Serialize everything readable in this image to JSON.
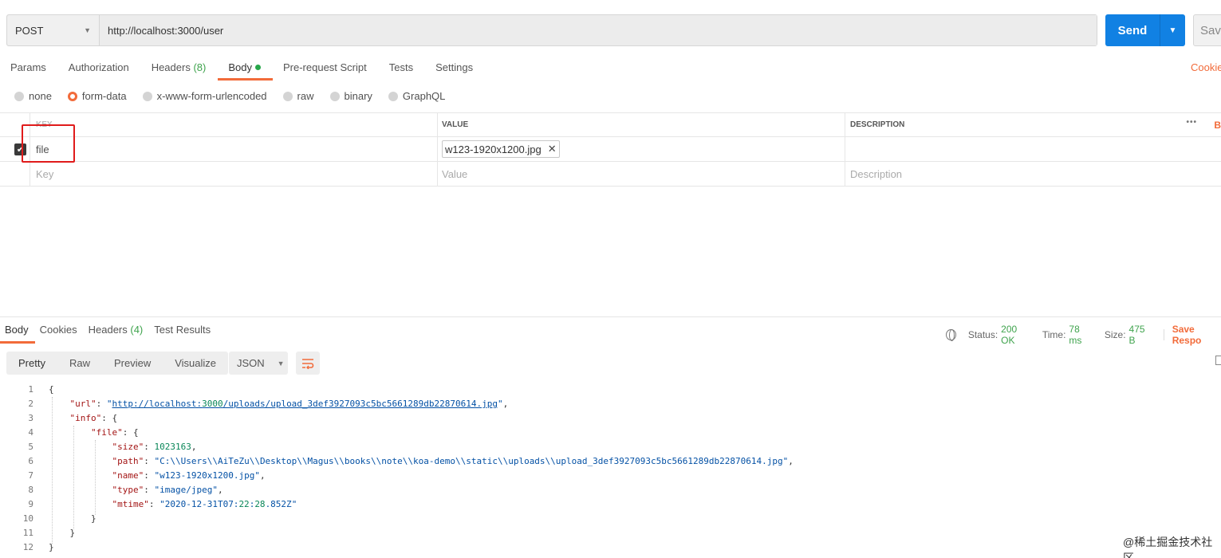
{
  "request": {
    "method": "POST",
    "url": "http://localhost:3000/user",
    "send_label": "Send",
    "save_label": "Save"
  },
  "req_tabs": [
    {
      "label": "Params",
      "count": ""
    },
    {
      "label": "Authorization",
      "count": ""
    },
    {
      "label": "Headers",
      "count": "(8)"
    },
    {
      "label": "Body",
      "count": ""
    },
    {
      "label": "Pre-request Script",
      "count": ""
    },
    {
      "label": "Tests",
      "count": ""
    },
    {
      "label": "Settings",
      "count": ""
    }
  ],
  "cookies_link": "Cookie",
  "body_types": [
    "none",
    "form-data",
    "x-www-form-urlencoded",
    "raw",
    "binary",
    "GraphQL"
  ],
  "body_type_selected": "form-data",
  "kv_table": {
    "headers": {
      "key": "KEY",
      "value": "VALUE",
      "description": "DESCRIPTION"
    },
    "more": "•••",
    "bulk": "B",
    "rows": [
      {
        "key": "file",
        "value": "w123-1920x1200.jpg",
        "checked": true
      }
    ],
    "placeholders": {
      "key": "Key",
      "value": "Value",
      "description": "Description"
    }
  },
  "response": {
    "tabs": [
      {
        "label": "Body",
        "count": ""
      },
      {
        "label": "Cookies",
        "count": ""
      },
      {
        "label": "Headers",
        "count": "(4)"
      },
      {
        "label": "Test Results",
        "count": ""
      }
    ],
    "status_label": "Status:",
    "status_value": "200 OK",
    "time_label": "Time:",
    "time_value": "78 ms",
    "size_label": "Size:",
    "size_value": "475 B",
    "save_response": "Save Respo",
    "view_modes": [
      "Pretty",
      "Raw",
      "Preview",
      "Visualize"
    ],
    "format": "JSON"
  },
  "code_lines": [
    "{",
    "    \"url\": \"http://localhost:3000/uploads/upload_3def3927093c5bc5661289db22870614.jpg\",",
    "    \"info\": {",
    "        \"file\": {",
    "            \"size\": 1023163,",
    "            \"path\": \"C:\\\\Users\\\\AiTeZu\\\\Desktop\\\\Magus\\\\books\\\\note\\\\koa-demo\\\\static\\\\uploads\\\\upload_3def3927093c5bc5661289db22870614.jpg\",",
    "            \"name\": \"w123-1920x1200.jpg\",",
    "            \"type\": \"image/jpeg\",",
    "            \"mtime\": \"2020-12-31T07:22:28.852Z\"",
    "        }",
    "    }",
    "}"
  ],
  "watermark": "@稀土掘金技术社区",
  "colors": {
    "accent": "#f26b3a",
    "send": "#1181e3",
    "status_ok": "#3fa34d",
    "highlight": "#e01b1b"
  }
}
